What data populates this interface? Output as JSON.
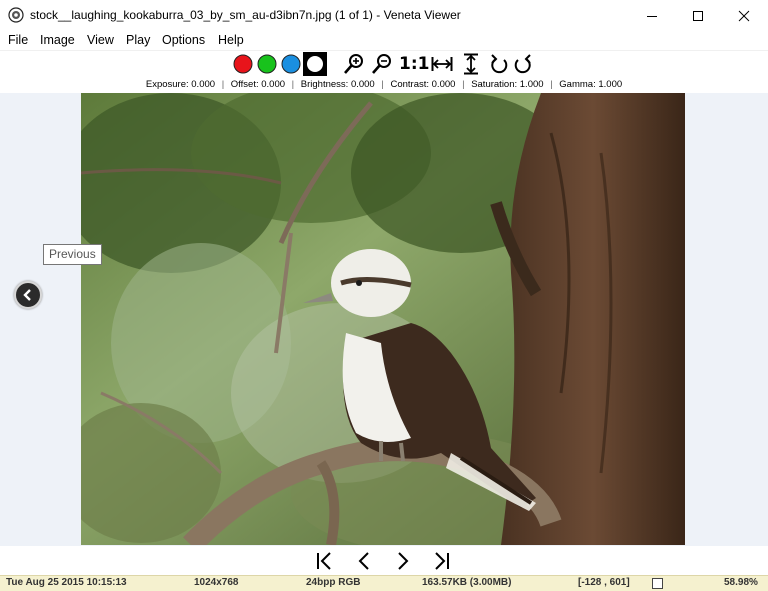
{
  "window": {
    "title": "stock__laughing_kookaburra_03_by_sm_au-d3ibn7n.jpg (1 of 1) - Veneta Viewer"
  },
  "menu": {
    "items": [
      "File",
      "Image",
      "View",
      "Play",
      "Options",
      "Help"
    ]
  },
  "toolbar": {
    "buttons": [
      "red-channel",
      "green-channel",
      "blue-channel",
      "all-channels",
      "zoom-in",
      "zoom-out",
      "actual-size",
      "fit-width",
      "fit-height",
      "rotate-left",
      "rotate-right"
    ],
    "actual_size_label": "1:1",
    "colors": {
      "red": "#e8141b",
      "green": "#18c21c",
      "blue": "#1a8fe0",
      "white": "#ffffff"
    }
  },
  "adjustments": {
    "exposure": "Exposure: 0.000",
    "offset": "Offset: 0.000",
    "brightness": "Brightness: 0.000",
    "contrast": "Contrast: 0.000",
    "saturation": "Saturation: 1.000",
    "gamma": "Gamma: 1.000",
    "separator": "|"
  },
  "viewer": {
    "tooltip": "Previous",
    "background": "#eef2f8"
  },
  "status": {
    "datetime": "Tue Aug 25 2015 10:15:13",
    "dimensions": "1024x768",
    "color_depth": "24bpp RGB",
    "file_size": "163.57KB (3.00MB)",
    "cursor": "[-128 , 601]",
    "zoom": "58.98%"
  }
}
